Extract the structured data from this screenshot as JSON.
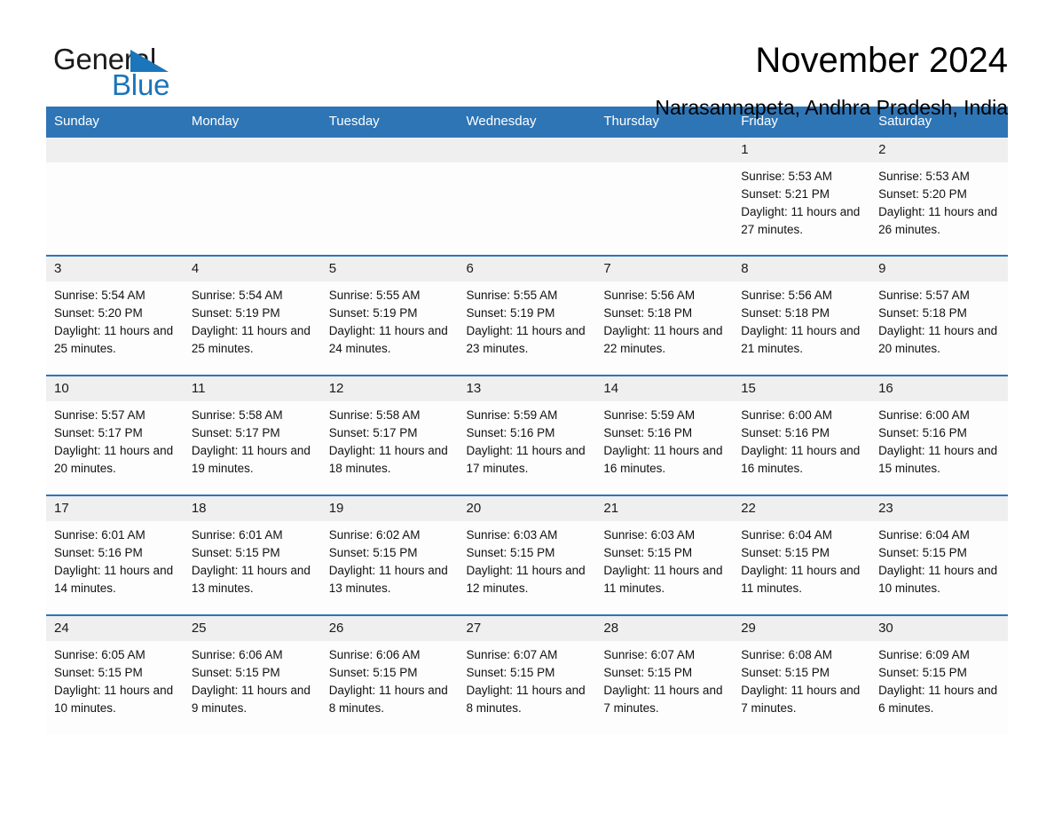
{
  "logo": {
    "word_one": "General",
    "word_two": "Blue",
    "triangle_color": "#1b75bb"
  },
  "header": {
    "title": "November 2024",
    "subtitle": "Narasannapeta, Andhra Pradesh, India"
  },
  "theme": {
    "header_blue": "#2e75b6",
    "daynum_band": "#efefef",
    "cell_background": "#fdfdfd",
    "text": "#111111"
  },
  "calendar": {
    "weekday_headers": [
      "Sunday",
      "Monday",
      "Tuesday",
      "Wednesday",
      "Thursday",
      "Friday",
      "Saturday"
    ],
    "labels": {
      "sunrise": "Sunrise:",
      "sunset": "Sunset:",
      "daylight": "Daylight:"
    },
    "weeks": [
      [
        {
          "day": "",
          "empty": true
        },
        {
          "day": "",
          "empty": true
        },
        {
          "day": "",
          "empty": true
        },
        {
          "day": "",
          "empty": true
        },
        {
          "day": "",
          "empty": true
        },
        {
          "day": "1",
          "sunrise": "Sunrise: 5:53 AM",
          "sunset": "Sunset: 5:21 PM",
          "daylight": "Daylight: 11 hours and 27 minutes."
        },
        {
          "day": "2",
          "sunrise": "Sunrise: 5:53 AM",
          "sunset": "Sunset: 5:20 PM",
          "daylight": "Daylight: 11 hours and 26 minutes."
        }
      ],
      [
        {
          "day": "3",
          "sunrise": "Sunrise: 5:54 AM",
          "sunset": "Sunset: 5:20 PM",
          "daylight": "Daylight: 11 hours and 25 minutes."
        },
        {
          "day": "4",
          "sunrise": "Sunrise: 5:54 AM",
          "sunset": "Sunset: 5:19 PM",
          "daylight": "Daylight: 11 hours and 25 minutes."
        },
        {
          "day": "5",
          "sunrise": "Sunrise: 5:55 AM",
          "sunset": "Sunset: 5:19 PM",
          "daylight": "Daylight: 11 hours and 24 minutes."
        },
        {
          "day": "6",
          "sunrise": "Sunrise: 5:55 AM",
          "sunset": "Sunset: 5:19 PM",
          "daylight": "Daylight: 11 hours and 23 minutes."
        },
        {
          "day": "7",
          "sunrise": "Sunrise: 5:56 AM",
          "sunset": "Sunset: 5:18 PM",
          "daylight": "Daylight: 11 hours and 22 minutes."
        },
        {
          "day": "8",
          "sunrise": "Sunrise: 5:56 AM",
          "sunset": "Sunset: 5:18 PM",
          "daylight": "Daylight: 11 hours and 21 minutes."
        },
        {
          "day": "9",
          "sunrise": "Sunrise: 5:57 AM",
          "sunset": "Sunset: 5:18 PM",
          "daylight": "Daylight: 11 hours and 20 minutes."
        }
      ],
      [
        {
          "day": "10",
          "sunrise": "Sunrise: 5:57 AM",
          "sunset": "Sunset: 5:17 PM",
          "daylight": "Daylight: 11 hours and 20 minutes."
        },
        {
          "day": "11",
          "sunrise": "Sunrise: 5:58 AM",
          "sunset": "Sunset: 5:17 PM",
          "daylight": "Daylight: 11 hours and 19 minutes."
        },
        {
          "day": "12",
          "sunrise": "Sunrise: 5:58 AM",
          "sunset": "Sunset: 5:17 PM",
          "daylight": "Daylight: 11 hours and 18 minutes."
        },
        {
          "day": "13",
          "sunrise": "Sunrise: 5:59 AM",
          "sunset": "Sunset: 5:16 PM",
          "daylight": "Daylight: 11 hours and 17 minutes."
        },
        {
          "day": "14",
          "sunrise": "Sunrise: 5:59 AM",
          "sunset": "Sunset: 5:16 PM",
          "daylight": "Daylight: 11 hours and 16 minutes."
        },
        {
          "day": "15",
          "sunrise": "Sunrise: 6:00 AM",
          "sunset": "Sunset: 5:16 PM",
          "daylight": "Daylight: 11 hours and 16 minutes."
        },
        {
          "day": "16",
          "sunrise": "Sunrise: 6:00 AM",
          "sunset": "Sunset: 5:16 PM",
          "daylight": "Daylight: 11 hours and 15 minutes."
        }
      ],
      [
        {
          "day": "17",
          "sunrise": "Sunrise: 6:01 AM",
          "sunset": "Sunset: 5:16 PM",
          "daylight": "Daylight: 11 hours and 14 minutes."
        },
        {
          "day": "18",
          "sunrise": "Sunrise: 6:01 AM",
          "sunset": "Sunset: 5:15 PM",
          "daylight": "Daylight: 11 hours and 13 minutes."
        },
        {
          "day": "19",
          "sunrise": "Sunrise: 6:02 AM",
          "sunset": "Sunset: 5:15 PM",
          "daylight": "Daylight: 11 hours and 13 minutes."
        },
        {
          "day": "20",
          "sunrise": "Sunrise: 6:03 AM",
          "sunset": "Sunset: 5:15 PM",
          "daylight": "Daylight: 11 hours and 12 minutes."
        },
        {
          "day": "21",
          "sunrise": "Sunrise: 6:03 AM",
          "sunset": "Sunset: 5:15 PM",
          "daylight": "Daylight: 11 hours and 11 minutes."
        },
        {
          "day": "22",
          "sunrise": "Sunrise: 6:04 AM",
          "sunset": "Sunset: 5:15 PM",
          "daylight": "Daylight: 11 hours and 11 minutes."
        },
        {
          "day": "23",
          "sunrise": "Sunrise: 6:04 AM",
          "sunset": "Sunset: 5:15 PM",
          "daylight": "Daylight: 11 hours and 10 minutes."
        }
      ],
      [
        {
          "day": "24",
          "sunrise": "Sunrise: 6:05 AM",
          "sunset": "Sunset: 5:15 PM",
          "daylight": "Daylight: 11 hours and 10 minutes."
        },
        {
          "day": "25",
          "sunrise": "Sunrise: 6:06 AM",
          "sunset": "Sunset: 5:15 PM",
          "daylight": "Daylight: 11 hours and 9 minutes."
        },
        {
          "day": "26",
          "sunrise": "Sunrise: 6:06 AM",
          "sunset": "Sunset: 5:15 PM",
          "daylight": "Daylight: 11 hours and 8 minutes."
        },
        {
          "day": "27",
          "sunrise": "Sunrise: 6:07 AM",
          "sunset": "Sunset: 5:15 PM",
          "daylight": "Daylight: 11 hours and 8 minutes."
        },
        {
          "day": "28",
          "sunrise": "Sunrise: 6:07 AM",
          "sunset": "Sunset: 5:15 PM",
          "daylight": "Daylight: 11 hours and 7 minutes."
        },
        {
          "day": "29",
          "sunrise": "Sunrise: 6:08 AM",
          "sunset": "Sunset: 5:15 PM",
          "daylight": "Daylight: 11 hours and 7 minutes."
        },
        {
          "day": "30",
          "sunrise": "Sunrise: 6:09 AM",
          "sunset": "Sunset: 5:15 PM",
          "daylight": "Daylight: 11 hours and 6 minutes."
        }
      ]
    ]
  }
}
